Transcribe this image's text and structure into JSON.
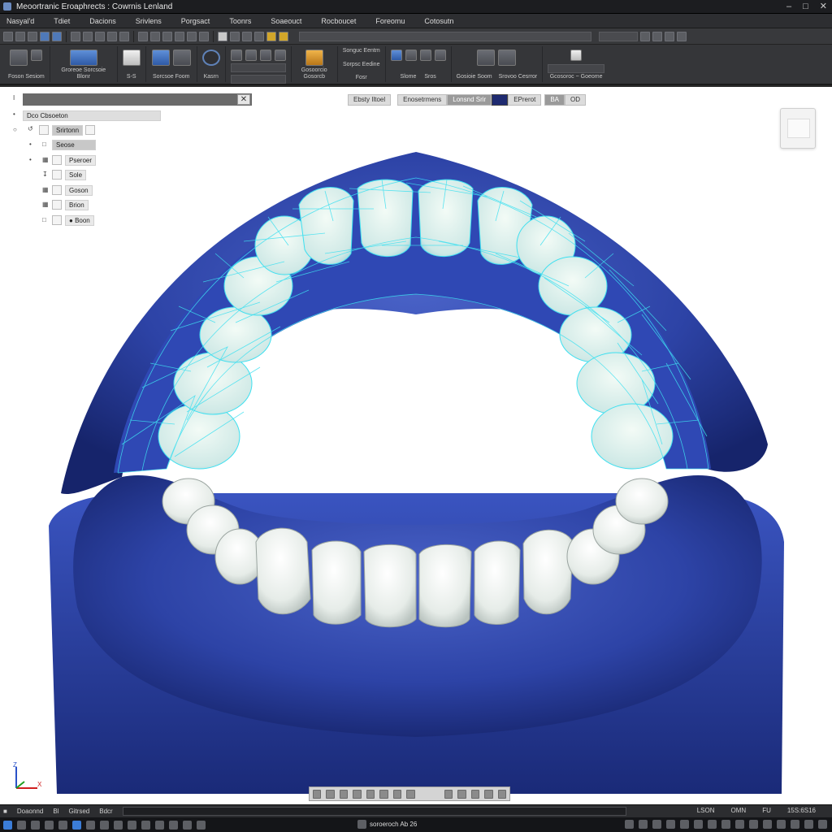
{
  "window": {
    "title": "Meoortranic Eroaphrects : Cowrnis Lenland"
  },
  "menu": {
    "items": [
      "Nasyal'd",
      "Tdiet",
      "Dacions",
      "Srivlens",
      "Porgsact",
      "Toonrs",
      "Soaeouct",
      "Rocboucet",
      "Foreomu",
      "Cotosutn"
    ]
  },
  "ribbon": {
    "groups": [
      {
        "label": "Foson Sesiom"
      },
      {
        "label": "Groreoe Sorcsoie Blonr"
      },
      {
        "label": "S-S"
      },
      {
        "label": "Sorcsoe Foom"
      },
      {
        "label": "Ssomoo Tlom"
      },
      {
        "label": "Kasrn"
      },
      {
        "label": "Gosoorcio Gosorcb"
      },
      {
        "label": "Songuc Eentm"
      },
      {
        "label": "Sorpsc Eedine"
      },
      {
        "label": "Fosr"
      },
      {
        "label": "Slome"
      },
      {
        "label": "Sros"
      },
      {
        "label": "Gosioie Soom"
      },
      {
        "label": "Srovoo Cesrror"
      },
      {
        "label": "Gcosoroc ~ Goeome"
      }
    ]
  },
  "tree": {
    "root_label": "Dco Cbsoeton",
    "group_label": "Srirtonn",
    "children": [
      {
        "label": "Seose"
      },
      {
        "label": "Pseroer"
      },
      {
        "label": "Sole"
      },
      {
        "label": "Goson"
      },
      {
        "label": "Brion"
      },
      {
        "label": "Boon"
      }
    ]
  },
  "view_tabs": [
    "Ebsty Iltoel",
    "Enosetrmens",
    "Lonsnd Srir",
    "EPrerot",
    "BA",
    "OD"
  ],
  "status": {
    "left": [
      "Doaonnd",
      "Bl",
      "Gitrsed",
      "Bdcr"
    ],
    "right": [
      "LSON",
      "OMN",
      "FU",
      "FUT"
    ],
    "coords": "15S:6S16"
  },
  "taskbar": {
    "center": "soroeroch Ab 26"
  },
  "colors": {
    "model_blue": "#2b3f9c",
    "wireframe": "#3ee0f0",
    "tooth": "#eef2ee"
  }
}
